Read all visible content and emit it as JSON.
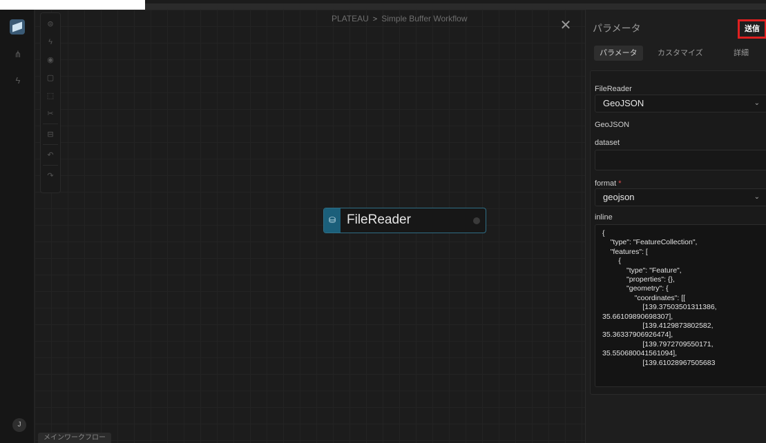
{
  "breadcrumb": {
    "project": "PLATEAU",
    "separator": ">",
    "workflow": "Simple Buffer Workflow"
  },
  "canvas": {
    "node_title": "FileReader",
    "flow_tab": "メインワークフロー"
  },
  "rail": {
    "avatar_initial": "J"
  },
  "panel": {
    "title": "パラメータ",
    "send_label": "送信",
    "tabs": [
      "パラメータ",
      "カスタマイズ",
      "詳細"
    ],
    "fields": {
      "reader_label": "FileReader",
      "reader_value": "GeoJSON",
      "format_heading": "GeoJSON",
      "dataset_label": "dataset",
      "format_label": "format",
      "format_required": "*",
      "format_value": "geojson",
      "inline_label": "inline",
      "inline_value": "{\n    \"type\": \"FeatureCollection\",\n    \"features\": [\n        {\n            \"type\": \"Feature\",\n            \"properties\": {},\n            \"geometry\": {\n                \"coordinates\": [[\n                    [139.37503501311386,\n35.66109890698307],\n                    [139.4129873802582,\n35.36337906926474],\n                    [139.7972709550171,\n35.550680041561094],\n                    [139.61028967505683"
    }
  },
  "colors": {
    "accent": "#1b5f7a",
    "node_border": "#2f6f86",
    "highlight": "#e02020"
  }
}
